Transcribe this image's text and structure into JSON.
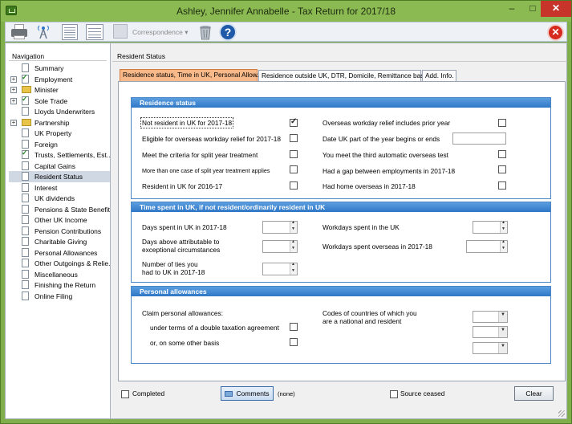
{
  "window": {
    "title": "Ashley, Jennifer Annabelle - Tax Return for 2017/18",
    "minimize": "–",
    "maximize": "□",
    "close": "✕"
  },
  "toolbar": {
    "correspondence": "Correspondence",
    "help": "?",
    "exit": "✕"
  },
  "navigation": {
    "heading": "Navigation",
    "items": [
      {
        "label": "Summary"
      },
      {
        "label": "Employment"
      },
      {
        "label": "Minister"
      },
      {
        "label": "Sole Trade"
      },
      {
        "label": "Lloyds Underwriters"
      },
      {
        "label": "Partnership"
      },
      {
        "label": "UK Property"
      },
      {
        "label": "Foreign"
      },
      {
        "label": "Trusts, Settlements, Est..."
      },
      {
        "label": "Capital Gains"
      },
      {
        "label": "Resident Status"
      },
      {
        "label": "Interest"
      },
      {
        "label": "UK dividends"
      },
      {
        "label": "Pensions & State Benefits"
      },
      {
        "label": "Other UK Income"
      },
      {
        "label": "Pension Contributions"
      },
      {
        "label": "Charitable Giving"
      },
      {
        "label": "Personal Allowances"
      },
      {
        "label": "Other Outgoings & Relie..."
      },
      {
        "label": "Miscellaneous"
      },
      {
        "label": "Finishing the Return"
      },
      {
        "label": "Online Filing"
      }
    ]
  },
  "main": {
    "heading": "Resident Status",
    "tabs": [
      {
        "label": "Residence status, Time in UK, Personal Allow."
      },
      {
        "label": "Residence outside UK, DTR, Domicile, Remittance basis"
      },
      {
        "label": "Add. Info."
      }
    ]
  },
  "residence": {
    "title": "Residence status",
    "not_resident": "Not resident in UK for 2017-18",
    "eligible_relief": "Eligible for overseas workday relief for 2017-18",
    "split_year": "Meet the criteria for split year treatment",
    "more_than_one": "More than one case of split year treatment applies",
    "resident_2016": "Resident in UK for 2016-17",
    "relief_prior_year": "Overseas workday relief includes prior year",
    "date_uk_part": "Date UK part of the year begins or ends",
    "third_test": "You meet the third automatic overseas test",
    "gap_employment": "Had a gap between employments in 2017-18",
    "home_overseas": "Had home overseas in 2017-18"
  },
  "time_spent": {
    "title": "Time spent in UK, if not resident/ordinarily resident in UK",
    "days_spent": "Days spent in UK in 2017-18",
    "days_above_1": "Days above attributable to",
    "days_above_2": "exceptional circumstances",
    "ties_1": "Number of ties you",
    "ties_2": "had to UK in 2017-18",
    "workdays_uk": "Workdays spent in the UK",
    "workdays_overseas": "Workdays spent overseas in 2017-18"
  },
  "allowances": {
    "title": "Personal allowances",
    "claim": "Claim personal allowances:",
    "dta": "under terms of a double taxation agreement",
    "other_basis": "or, on some other basis",
    "codes_1": "Codes of countries of which you",
    "codes_2": "are a national and resident"
  },
  "footer": {
    "completed": "Completed",
    "comments": "Comments",
    "none": "(none)",
    "source_ceased": "Source ceased",
    "clear": "Clear"
  },
  "colors": {
    "frame": "#7fae4a",
    "group_header": "#2f77c6",
    "active_tab": "#f8b98a"
  }
}
